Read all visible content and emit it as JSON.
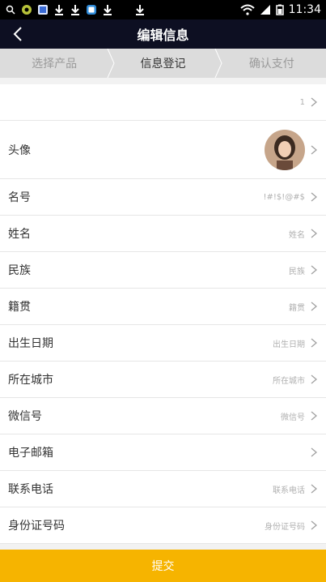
{
  "statusbar": {
    "icons": [
      "search-icon",
      "app-icon",
      "gallery-icon",
      "download-icon",
      "download-icon",
      "browser-icon",
      "download-icon",
      "download-icon"
    ],
    "time": "11:34",
    "right_icons": [
      "wifi-icon",
      "signal-icon",
      "battery-icon"
    ]
  },
  "header": {
    "title": "编辑信息"
  },
  "steps": [
    {
      "label": "选择产品",
      "state": "inactive"
    },
    {
      "label": "信息登记",
      "state": "active"
    },
    {
      "label": "确认支付",
      "state": "inactive"
    }
  ],
  "rows": [
    {
      "label": "",
      "value": "1",
      "type": "text"
    },
    {
      "label": "头像",
      "value": "",
      "type": "avatar"
    },
    {
      "label": "名号",
      "value": "!#!$!@#$",
      "type": "text"
    },
    {
      "label": "姓名",
      "value": "姓名",
      "type": "text"
    },
    {
      "label": "民族",
      "value": "民族",
      "type": "text"
    },
    {
      "label": "籍贯",
      "value": "籍贯",
      "type": "text"
    },
    {
      "label": "出生日期",
      "value": "出生日期",
      "type": "text"
    },
    {
      "label": "所在城市",
      "value": "所在城市",
      "type": "text"
    },
    {
      "label": "微信号",
      "value": "微信号",
      "type": "text"
    },
    {
      "label": "电子邮箱",
      "value": "",
      "type": "text"
    },
    {
      "label": "联系电话",
      "value": "联系电话",
      "type": "text"
    },
    {
      "label": "身份证号码",
      "value": "身份证号码",
      "type": "text"
    }
  ],
  "footer": {
    "submit_label": "提交"
  },
  "colors": {
    "header_bg": "#0d0f22",
    "submit_bg": "#f6b400"
  }
}
